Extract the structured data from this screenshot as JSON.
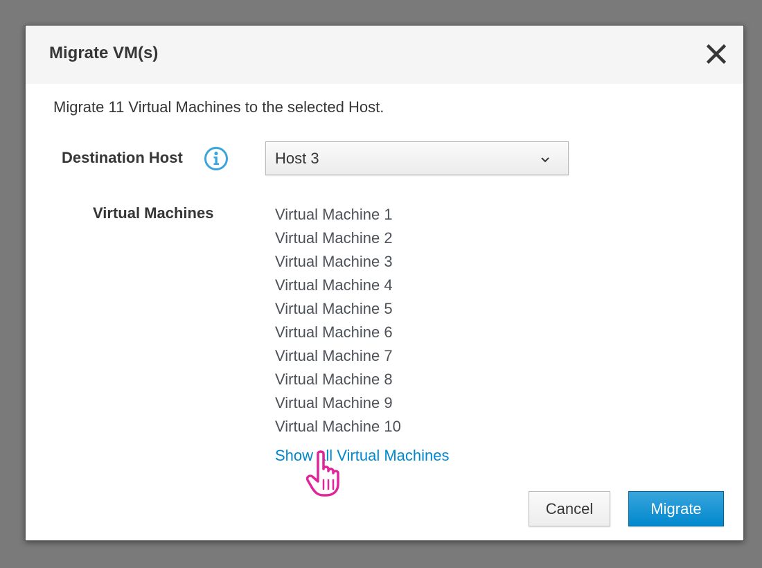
{
  "dialog": {
    "title": "Migrate VM(s)",
    "close_icon": "close-icon",
    "intro": "Migrate 11 Virtual Machines to the selected Host."
  },
  "form": {
    "destination_label": "Destination Host",
    "info_icon": "info-circle-icon",
    "destination_value": "Host 3",
    "vms_label": "Virtual Machines",
    "vms": [
      "Virtual Machine 1",
      "Virtual Machine 2",
      "Virtual Machine 3",
      "Virtual Machine 4",
      "Virtual Machine 5",
      "Virtual Machine 6",
      "Virtual Machine 7",
      "Virtual Machine 8",
      "Virtual Machine 9",
      "Virtual Machine 10"
    ],
    "show_all_link": "Show all Virtual Machines"
  },
  "footer": {
    "cancel_label": "Cancel",
    "migrate_label": "Migrate"
  },
  "colors": {
    "accent": "#0088ce",
    "primary_button": "#0088ce",
    "info_icon": "#39a5dc",
    "cursor": "#e0249b"
  }
}
